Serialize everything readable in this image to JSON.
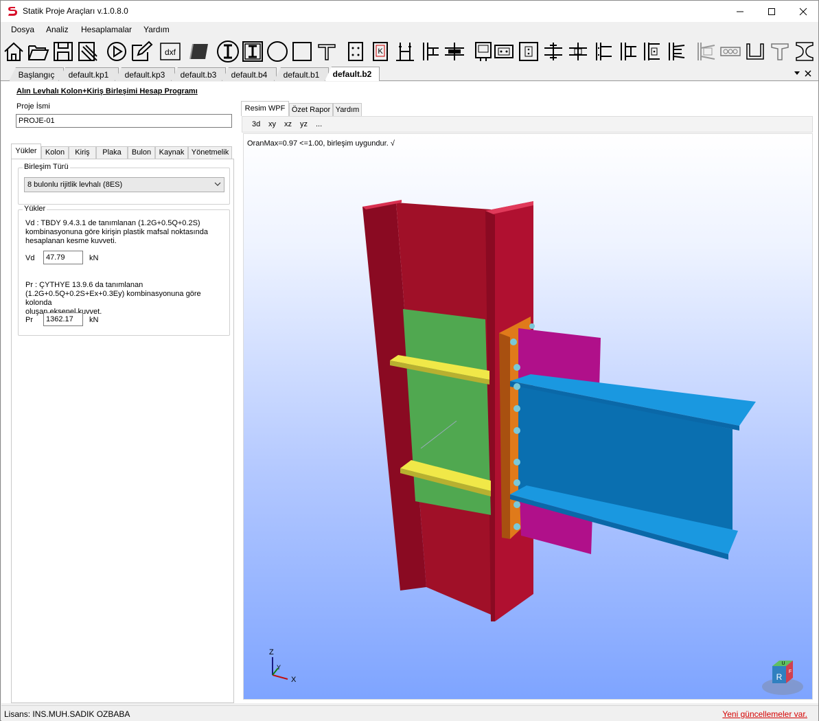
{
  "window": {
    "title": "Statik Proje Araçları v.1.0.8.0"
  },
  "menu": [
    "Dosya",
    "Analiz",
    "Hesaplamalar",
    "Yardım"
  ],
  "toolbar": {
    "icons": [
      "home-icon",
      "open-folder-icon",
      "save-icon",
      "settings-tool-icon",
      "play-icon",
      "edit-icon",
      "dxf-icon",
      "plate-icon",
      "i-section-round-icon",
      "i-section-square-icon",
      "circle-section-icon",
      "square-section-icon",
      "t-section-icon",
      "base-plate-icon",
      "k-plate-icon",
      "beam-column-icon",
      "column-splice-icon",
      "beam-splice-icon",
      "anchor-plate-icon",
      "bolted-plate-icon",
      "end-plate-icon",
      "shear-tab-icon",
      "flange-plate-icon",
      "moment-connection-icon",
      "column-stiffener-icon",
      "double-angle-icon",
      "web-angle-icon",
      "seat-angle-icon",
      "gusset-icon",
      "bolt-row-icon",
      "channel-icon",
      "tee-icon",
      "i-beam-icon"
    ],
    "dxf_label": "dxf"
  },
  "doc_tabs": [
    {
      "label": "Başlangıç",
      "active": false
    },
    {
      "label": "default.kp1",
      "active": false
    },
    {
      "label": "default.kp3",
      "active": false
    },
    {
      "label": "default.b3",
      "active": false
    },
    {
      "label": "default.b4",
      "active": false
    },
    {
      "label": "default.b1",
      "active": false
    },
    {
      "label": "default.b2",
      "active": true
    }
  ],
  "form": {
    "title": "Alın Levhalı Kolon+Kiriş Birleşimi Hesap Programı",
    "project_name_label": "Proje İsmi",
    "project_name_value": "PROJE-01"
  },
  "left_tabs": [
    {
      "label": "Yükler",
      "active": true
    },
    {
      "label": "Kolon",
      "active": false
    },
    {
      "label": "Kiriş",
      "active": false
    },
    {
      "label": "Plaka",
      "active": false
    },
    {
      "label": "Bulon",
      "active": false
    },
    {
      "label": "Kaynak",
      "active": false
    },
    {
      "label": "Yönetmelik",
      "active": false
    }
  ],
  "connection_type": {
    "legend": "Birleşim Türü",
    "selected": "8 bulonlu rijitlik levhalı (8ES)"
  },
  "loads": {
    "legend": "Yükler",
    "vd_desc": [
      "Vd : TBDY 9.4.3.1 de tanımlanan (1.2G+0.5Q+0.2S)",
      "kombinasyonuna göre kirişin plastik mafsal noktasında",
      "hesaplanan kesme kuvveti."
    ],
    "vd_label": "Vd",
    "vd_value": "47.79",
    "vd_unit": "kN",
    "pr_desc": [
      "Pr : ÇYTHYE 13.9.6 da tanımlanan",
      "(1.2G+0.5Q+0.2S+Ex+0.3Ey) kombinasyonuna göre kolonda",
      "oluşan eksenel kuvvet."
    ],
    "pr_label": "Pr",
    "pr_value": "1362.17",
    "pr_unit": "kN"
  },
  "right_tabs": [
    {
      "label": "Resim WPF",
      "active": true
    },
    {
      "label": "Özet Rapor",
      "active": false
    },
    {
      "label": "Yardım",
      "active": false
    }
  ],
  "view_tools": [
    "3d",
    "xy",
    "xz",
    "yz",
    "..."
  ],
  "viewport": {
    "status_text": "OranMax=0.97 <=1.00, birleşim uygundur. √",
    "axis_labels": {
      "z": "Z",
      "y": "Y",
      "x": "X"
    },
    "cube_labels": {
      "front": "R",
      "top": "U",
      "side": "F"
    },
    "colors": {
      "column": "#b01030",
      "end_plate": "#e07a1a",
      "beam": "#1a90d8",
      "stiffener": "#b0108a",
      "continuity_plate": "#f0e848",
      "doubler_plate": "#50a850",
      "bolt": "#7ac8d8",
      "background_top": "#ffffff",
      "background_bottom": "#7ea4ff"
    }
  },
  "status": {
    "license": "Lisans: INS.MUH.SADIK OZBABA",
    "update": "Yeni güncellemeler var."
  }
}
